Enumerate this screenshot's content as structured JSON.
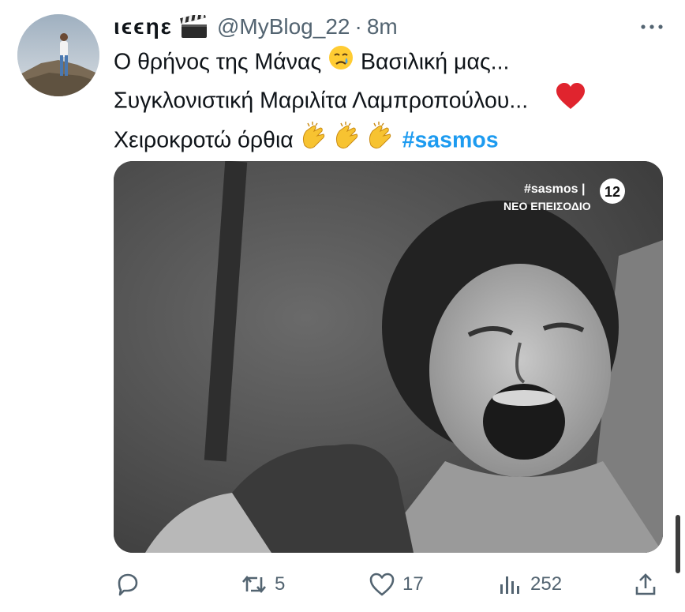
{
  "tweet": {
    "display_name": "ιϵϵηε",
    "handle": "@MyBlog_22",
    "separator": "·",
    "time": "8m",
    "lines": [
      "Ο θρήνος της Μάνας",
      "Βασιλική μας...",
      "Συγκλονιστική Μαριλίτα Λαμπροπούλου...",
      "Χειροκροτώ όρθια"
    ],
    "hashtag": "#sasmos",
    "media": {
      "overlay_hashtag": "#sasmos |",
      "overlay_caption": "ΝΕΟ ΕΠΕΙΣΟΔΙΟ",
      "rating": "12"
    },
    "actions": {
      "reply_count": "",
      "retweet_count": "5",
      "like_count": "17",
      "view_count": "252"
    },
    "icons": [
      "clapperboard-icon",
      "crying-face-icon",
      "red-heart-icon",
      "clapping-hands-icon",
      "more-icon",
      "reply-icon",
      "retweet-icon",
      "like-icon",
      "views-icon",
      "share-icon"
    ],
    "colors": {
      "accent": "#1d9bf0",
      "muted": "#536471",
      "text": "#0f1419"
    }
  }
}
